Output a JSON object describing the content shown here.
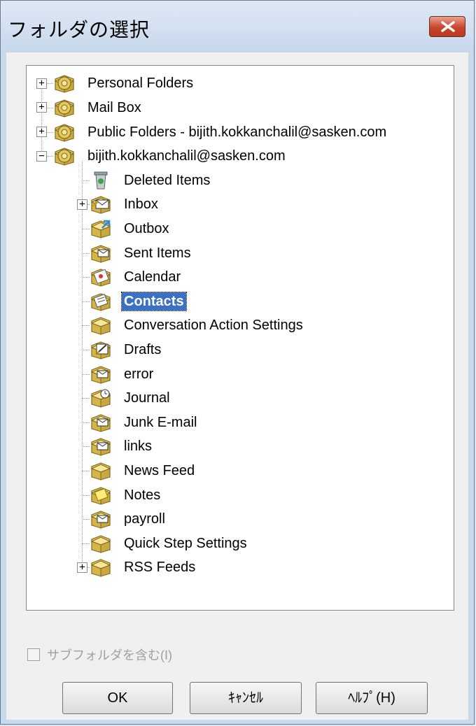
{
  "dialog": {
    "title": "フォルダの選択",
    "close_icon": "close-x-icon",
    "accent_close": "#c8452b"
  },
  "tree": {
    "items": [
      {
        "label": "Personal Folders",
        "level": 0,
        "expander": "+",
        "icon": "store-icon"
      },
      {
        "label": "Mail Box",
        "level": 0,
        "expander": "+",
        "icon": "store-icon"
      },
      {
        "label": "Public Folders - bijith.kokkanchalil@sasken.com",
        "level": 0,
        "expander": "+",
        "icon": "store-icon"
      },
      {
        "label": "bijith.kokkanchalil@sasken.com",
        "level": 0,
        "expander": "−",
        "icon": "store-icon"
      },
      {
        "label": "Deleted Items",
        "level": 1,
        "expander": "",
        "icon": "trash-icon"
      },
      {
        "label": "Inbox",
        "level": 1,
        "expander": "+",
        "icon": "inbox-icon"
      },
      {
        "label": "Outbox",
        "level": 1,
        "expander": "",
        "icon": "outbox-icon"
      },
      {
        "label": "Sent Items",
        "level": 1,
        "expander": "",
        "icon": "sent-items-icon"
      },
      {
        "label": "Calendar",
        "level": 1,
        "expander": "",
        "icon": "calendar-icon"
      },
      {
        "label": "Contacts",
        "level": 1,
        "expander": "",
        "icon": "contacts-icon",
        "selected": true
      },
      {
        "label": "Conversation Action Settings",
        "level": 1,
        "expander": "",
        "icon": "folder-icon"
      },
      {
        "label": "Drafts",
        "level": 1,
        "expander": "",
        "icon": "drafts-icon"
      },
      {
        "label": "error",
        "level": 1,
        "expander": "",
        "icon": "mail-folder-icon"
      },
      {
        "label": "Journal",
        "level": 1,
        "expander": "",
        "icon": "journal-icon"
      },
      {
        "label": "Junk E-mail",
        "level": 1,
        "expander": "",
        "icon": "mail-folder-icon"
      },
      {
        "label": "links",
        "level": 1,
        "expander": "",
        "icon": "mail-folder-icon"
      },
      {
        "label": "News Feed",
        "level": 1,
        "expander": "",
        "icon": "folder-icon"
      },
      {
        "label": "Notes",
        "level": 1,
        "expander": "",
        "icon": "notes-icon"
      },
      {
        "label": "payroll",
        "level": 1,
        "expander": "",
        "icon": "mail-folder-icon"
      },
      {
        "label": "Quick Step Settings",
        "level": 1,
        "expander": "",
        "icon": "folder-icon"
      },
      {
        "label": "RSS Feeds",
        "level": 1,
        "expander": "+",
        "icon": "folder-icon"
      }
    ],
    "selected_color": "#3a71c4"
  },
  "options": {
    "include_subfolders_label": "サブフォルダを含む(I)",
    "include_subfolders_checked": false,
    "include_subfolders_enabled": false
  },
  "buttons": {
    "ok_label": "OK",
    "cancel_label": "ｷｬﾝｾﾙ",
    "help_label": "ﾍﾙﾌﾟ(H)"
  }
}
